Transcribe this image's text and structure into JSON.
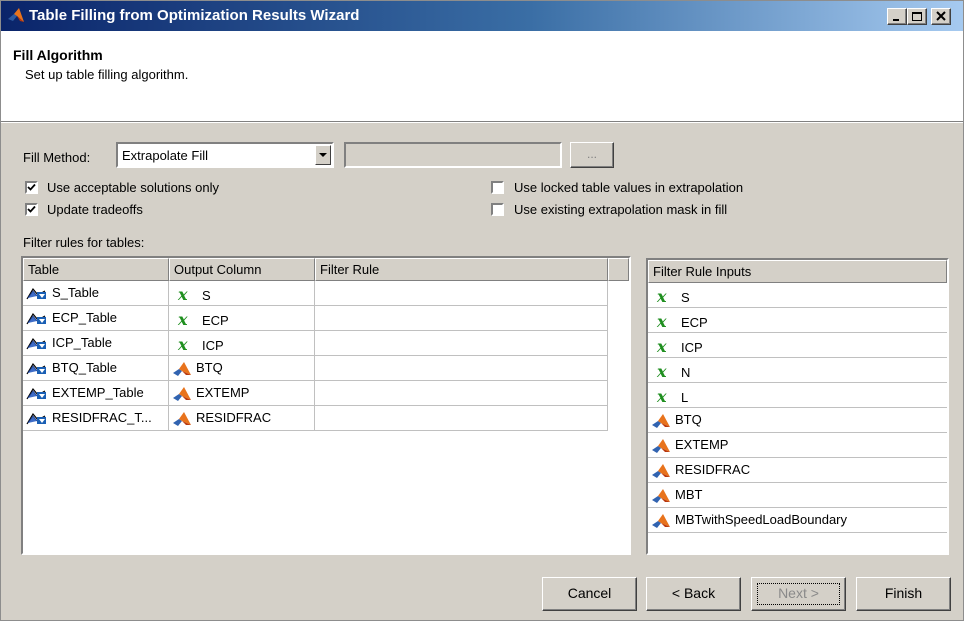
{
  "window": {
    "title": "Table Filling from Optimization Results Wizard"
  },
  "header": {
    "title": "Fill Algorithm",
    "subtitle": "Set up table filling algorithm."
  },
  "fill_method": {
    "label": "Fill Method:",
    "value": "Extrapolate Fill",
    "browse_label": "..."
  },
  "options": [
    {
      "label": "Use acceptable solutions only",
      "checked": true
    },
    {
      "label": "Update tradeoffs",
      "checked": true
    },
    {
      "label": "Use locked table values in extrapolation",
      "checked": false
    },
    {
      "label": "Use existing extrapolation mask in fill",
      "checked": false
    }
  ],
  "filter_rules": {
    "label": "Filter rules for tables:",
    "columns": [
      "Table",
      "Output Column",
      "Filter Rule"
    ],
    "rows": [
      {
        "table": "S_Table",
        "output": "S",
        "output_icon": "variable-x-icon",
        "rule": ""
      },
      {
        "table": "ECP_Table",
        "output": "ECP",
        "output_icon": "variable-x-icon",
        "rule": ""
      },
      {
        "table": "ICP_Table",
        "output": "ICP",
        "output_icon": "variable-x-icon",
        "rule": ""
      },
      {
        "table": "BTQ_Table",
        "output": "BTQ",
        "output_icon": "model-icon",
        "rule": ""
      },
      {
        "table": "EXTEMP_Table",
        "output": "EXTEMP",
        "output_icon": "model-icon",
        "rule": ""
      },
      {
        "table": "RESIDFRAC_T...",
        "output": "RESIDFRAC",
        "output_icon": "model-icon",
        "rule": ""
      }
    ]
  },
  "filter_inputs": {
    "header": "Filter Rule Inputs",
    "items": [
      {
        "label": "S",
        "icon": "variable-x-icon"
      },
      {
        "label": "ECP",
        "icon": "variable-x-icon"
      },
      {
        "label": "ICP",
        "icon": "variable-x-icon"
      },
      {
        "label": "N",
        "icon": "variable-x-icon"
      },
      {
        "label": "L",
        "icon": "variable-x-icon"
      },
      {
        "label": "BTQ",
        "icon": "model-icon"
      },
      {
        "label": "EXTEMP",
        "icon": "model-icon"
      },
      {
        "label": "RESIDFRAC",
        "icon": "model-icon"
      },
      {
        "label": "MBT",
        "icon": "model-icon"
      },
      {
        "label": "MBTwithSpeedLoadBoundary",
        "icon": "model-icon"
      }
    ]
  },
  "buttons": {
    "cancel": "Cancel",
    "back": "< Back",
    "next": "Next >",
    "finish": "Finish"
  },
  "colors": {
    "title_gradient_start": "#0a246a",
    "title_gradient_end": "#a6caf0",
    "dialog_bg": "#d4d0c8",
    "variable_icon": "#1f8f1f"
  }
}
